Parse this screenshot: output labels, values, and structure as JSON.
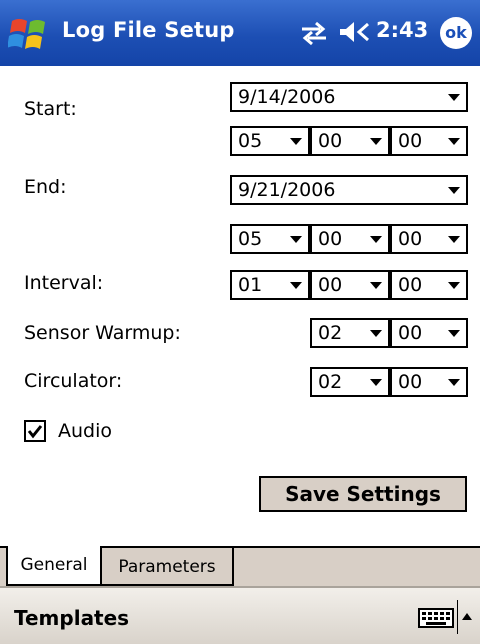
{
  "titlebar": {
    "title": "Log File Setup",
    "clock": "2:43",
    "ok_label": "ok"
  },
  "form": {
    "start_label": "Start:",
    "start_date": "9/14/2006",
    "start_hour": "05",
    "start_min": "00",
    "start_sec": "00",
    "end_label": "End:",
    "end_date": "9/21/2006",
    "end_hour": "05",
    "end_min": "00",
    "end_sec": "00",
    "interval_label": "Interval:",
    "interval_hour": "01",
    "interval_min": "00",
    "interval_sec": "00",
    "warmup_label": "Sensor Warmup:",
    "warmup_a": "02",
    "warmup_b": "00",
    "circ_label": "Circulator:",
    "circ_a": "02",
    "circ_b": "00",
    "audio_label": "Audio",
    "audio_checked": true,
    "save_label": "Save Settings"
  },
  "tabs": [
    {
      "label": "General",
      "active": true
    },
    {
      "label": "Parameters",
      "active": false
    }
  ],
  "menubar": {
    "templates_label": "Templates"
  },
  "colors": {
    "titlebar": "#1d4fb4",
    "chrome": "#d8cfc6"
  }
}
